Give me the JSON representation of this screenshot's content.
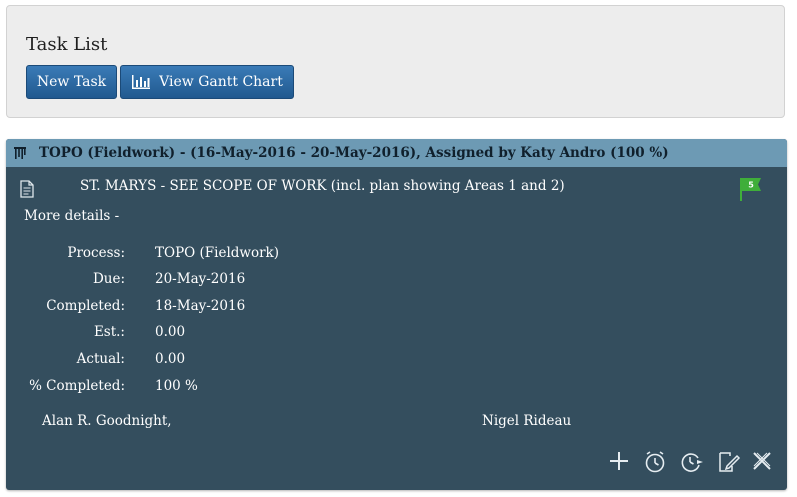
{
  "header": {
    "title": "Task List",
    "buttons": {
      "new_task": "New Task",
      "gantt": "View Gantt Chart"
    }
  },
  "task": {
    "header_text": "TOPO (Fieldwork) - (16-May-2016 - 20-May-2016), Assigned by Katy Andro (100 %)",
    "description": "ST. MARYS - SEE SCOPE OF WORK (incl. plan showing Areas 1 and 2)",
    "flag_count": "5",
    "more_details": "More details -",
    "details": [
      {
        "label": "Process:",
        "value": "TOPO (Fieldwork)"
      },
      {
        "label": "Due:",
        "value": "20-May-2016"
      },
      {
        "label": "Completed:",
        "value": "18-May-2016"
      },
      {
        "label": "Est.:",
        "value": "0.00"
      },
      {
        "label": "Actual:",
        "value": "0.00"
      },
      {
        "label": "% Completed:",
        "value": "100 %"
      }
    ],
    "people": [
      "Alan R. Goodnight,",
      "Nigel Rideau"
    ],
    "actions": [
      "add-icon",
      "clock-icon",
      "clock-forward-icon",
      "edit-icon",
      "close-icon"
    ]
  },
  "colors": {
    "card_bg": "#344e5e",
    "header_bg": "#6d9ab4",
    "button_bg": "#2a69a4",
    "flag": "#3fae3a"
  }
}
